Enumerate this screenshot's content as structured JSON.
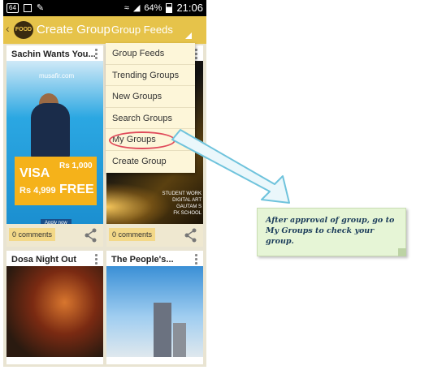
{
  "status_bar": {
    "badge": "64",
    "battery": "64%",
    "time": "21:06"
  },
  "header": {
    "logo_text": "FOOD",
    "title": "Create Group",
    "feeds_label": "Group Feeds"
  },
  "dropdown": {
    "items": [
      "Group Feeds",
      "Trending Groups",
      "New Groups",
      "Search Groups",
      "My Groups",
      "Create Group"
    ],
    "highlighted": "My Groups"
  },
  "cards": [
    {
      "title": "Sachin Wants You...",
      "comments": "0 comments",
      "ad": {
        "brand": "musafir.com",
        "visa": "VISA",
        "visa_price": "Rs 4,999",
        "voucher": "Rs 1,000",
        "free": "FREE",
        "apply": "Apply now"
      }
    },
    {
      "title": "",
      "comments": "0 comments",
      "overlay_text": "STUDENT WORK\nDIGITAL ART\nGAUTAM S\nFK SCHOOL"
    },
    {
      "title": "Dosa Night Out"
    },
    {
      "title": "The People's..."
    }
  ],
  "callout": {
    "text": "After approval of group, go to My Groups to check your group."
  },
  "colors": {
    "header": "#e6c34a",
    "menu_bg": "#fdf6d9",
    "callout_bg": "#e6f5d6",
    "highlight_ring": "#e04a5a",
    "arrow": "#6fc3dc"
  }
}
